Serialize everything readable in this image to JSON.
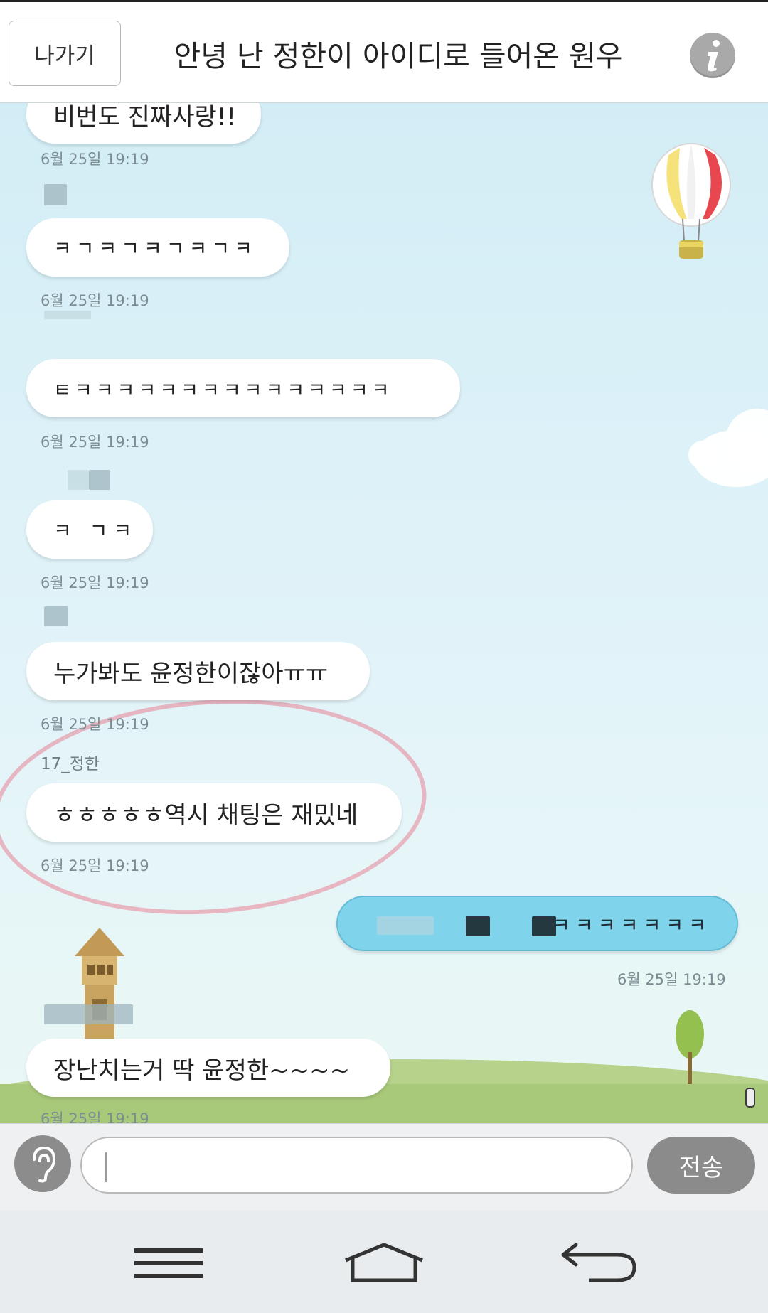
{
  "header": {
    "exit_label": "나가기",
    "title": "안녕 난 정한이 아이디로 들어온 원우",
    "info_icon": "info-icon"
  },
  "messages": [
    {
      "type": "received",
      "text": "비번도 진짜사랑!!",
      "time": "6월 25일 19:19"
    },
    {
      "type": "received",
      "text": "ㅋㄱㅋㄱㅋㄱㅋㄱㅋ",
      "time": "6월 25일 19:19"
    },
    {
      "type": "received",
      "text": "ㅌㅋㅋㅋㅋㅋㅋㅋㅋㅋㅋㅋㅋㅋㅋㅋ",
      "time": "6월 25일 19:19"
    },
    {
      "type": "received",
      "text": "ㅋ ㄱㅋ",
      "time": "6월 25일 19:19"
    },
    {
      "type": "received",
      "text": "누가봐도 윤정한이잖아ㅠㅠ",
      "time": "6월 25일 19:19"
    },
    {
      "type": "received",
      "sender": "17_정한",
      "text": "ㅎㅎㅎㅎㅎ역시 채팅은 재밌네",
      "time": "6월 25일 19:19"
    },
    {
      "type": "sent",
      "text": "ㅋㅋㅋㅋㅋㅋㅋ",
      "time": "6월 25일 19:19"
    },
    {
      "type": "received",
      "text": "장난치는거 딱 윤정한~~~~",
      "time": "6월 25일 19:19"
    }
  ],
  "input": {
    "placeholder": "",
    "voice_icon": "voice-icon",
    "send_label": "전송"
  },
  "navbar": {
    "menu_icon": "menu-icon",
    "home_icon": "home-icon",
    "back_icon": "back-icon"
  },
  "colors": {
    "sent_bubble": "#7fd3ea",
    "received_bubble": "#ffffff",
    "chat_bg": "#dff2f7",
    "highlight": "#e88296"
  }
}
